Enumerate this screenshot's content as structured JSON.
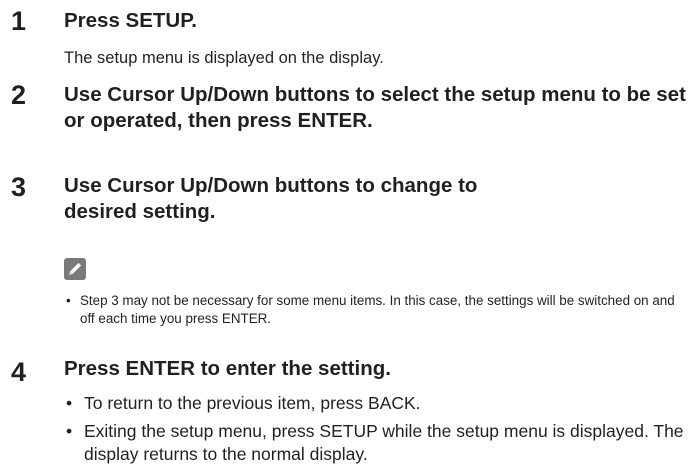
{
  "steps": [
    {
      "number": "1",
      "title": "Press SETUP.",
      "description": "The setup menu is displayed on the display."
    },
    {
      "number": "2",
      "title": "Use Cursor Up/Down buttons to select the setup menu to be set or operated, then press ENTER."
    },
    {
      "number": "3",
      "title": "Use Cursor Up/Down buttons to change to desired setting.",
      "note_icon": "pencil-icon",
      "note": "Step 3 may not be necessary for some menu items. In this case, the settings will be switched on and off each time you press ENTER."
    },
    {
      "number": "4",
      "title": "Press ENTER to enter the setting.",
      "bullets": [
        "To return to the previous item, press BACK.",
        "Exiting the setup menu, press SETUP while the setup menu is displayed. The display returns to the normal display."
      ]
    }
  ],
  "bullet_symbol": "•"
}
